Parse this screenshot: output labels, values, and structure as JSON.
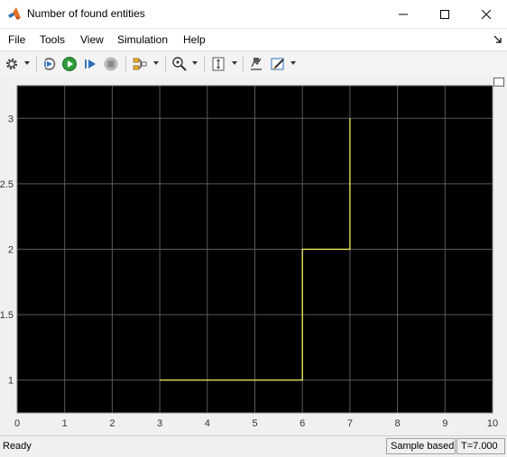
{
  "window": {
    "title": "Number of found entities"
  },
  "menu": {
    "file": "File",
    "tools": "Tools",
    "view": "View",
    "simulation": "Simulation",
    "help": "Help"
  },
  "toolbar": {
    "items": [
      "gear-icon",
      "step-back-icon",
      "run-icon",
      "step-forward-icon",
      "stop-icon",
      "signal-selector-icon",
      "zoom-icon",
      "scale-axes-icon",
      "highlight-icon",
      "style-icon"
    ]
  },
  "status": {
    "state": "Ready",
    "mode": "Sample based",
    "time": "T=7.000"
  },
  "colors": {
    "plot_bg": "#000000",
    "grid": "#5a5a5a",
    "line": "#ffff66",
    "tick": "#c8c8c8"
  },
  "chart_data": {
    "type": "line",
    "title": "",
    "xlabel": "",
    "ylabel": "",
    "xlim": [
      0,
      10
    ],
    "ylim": [
      0.75,
      3.25
    ],
    "xticks": [
      0,
      1,
      2,
      3,
      4,
      5,
      6,
      7,
      8,
      9,
      10
    ],
    "yticks": [
      1,
      1.5,
      2,
      2.5,
      3
    ],
    "yticklabels": [
      "1",
      "1.5",
      "2",
      "2.5",
      "3"
    ],
    "grid": true,
    "step": true,
    "series": [
      {
        "x": [
          3,
          6,
          6,
          7,
          7
        ],
        "y": [
          1,
          1,
          2,
          2,
          3
        ]
      }
    ]
  }
}
